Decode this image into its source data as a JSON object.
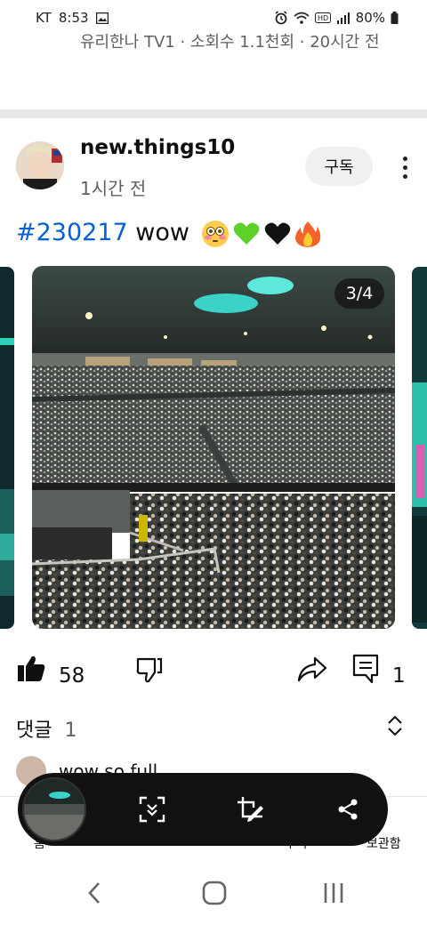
{
  "status_bar": {
    "carrier": "KT",
    "time": "8:53",
    "battery": "80%"
  },
  "previous_post": {
    "meta": "유리한나 TV1 · 소회수 1.1천회 · 20시간 전"
  },
  "post": {
    "channel_name": "new.things10",
    "time": "1시간 전",
    "subscribe_label": "구독",
    "hashtag": "#230217",
    "text": "wow",
    "emojis": [
      "flushed-face",
      "green-heart",
      "black-heart",
      "fire"
    ],
    "image_counter": "3/4"
  },
  "actions": {
    "like_count": "58",
    "comment_count": "1"
  },
  "comments": {
    "label": "댓글",
    "count": "1",
    "preview_text": "wow so full"
  },
  "bottom_nav": {
    "items": [
      "홈",
      "Shorts",
      "",
      "구독",
      "보관함"
    ]
  },
  "colors": {
    "hashtag": "#065fd4",
    "toolbar": "#111111"
  }
}
